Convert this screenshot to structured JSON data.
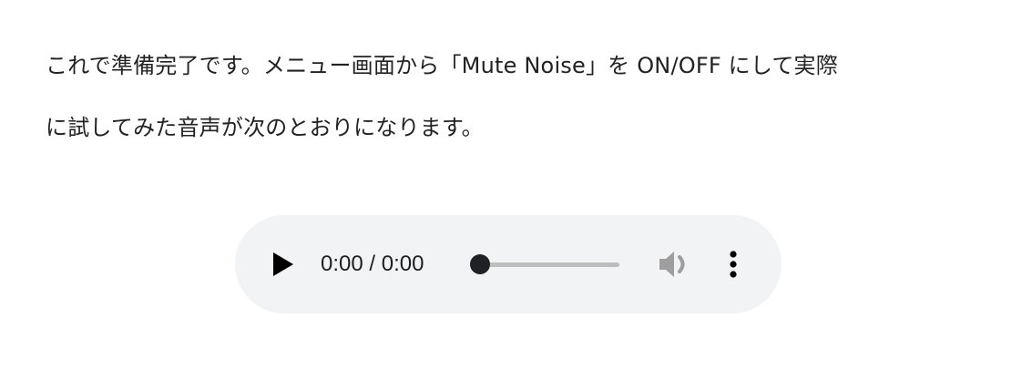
{
  "paragraph": {
    "line1": "これで準備完了です。メニュー画面から「Mute Noise」を ON/OFF にして実際",
    "line2": "に試してみた音声が次のとおりになります。"
  },
  "audio_player": {
    "time": "0:00 / 0:00",
    "progress_fraction": 0,
    "icons": {
      "play": "play-icon",
      "volume": "volume-icon",
      "menu": "more-vert-icon"
    },
    "colors": {
      "background": "#f1f3f4",
      "track": "#bdbdbd",
      "thumb": "#202124",
      "icon": "#1f1f1f",
      "volume_icon": "#9e9e9e"
    }
  }
}
